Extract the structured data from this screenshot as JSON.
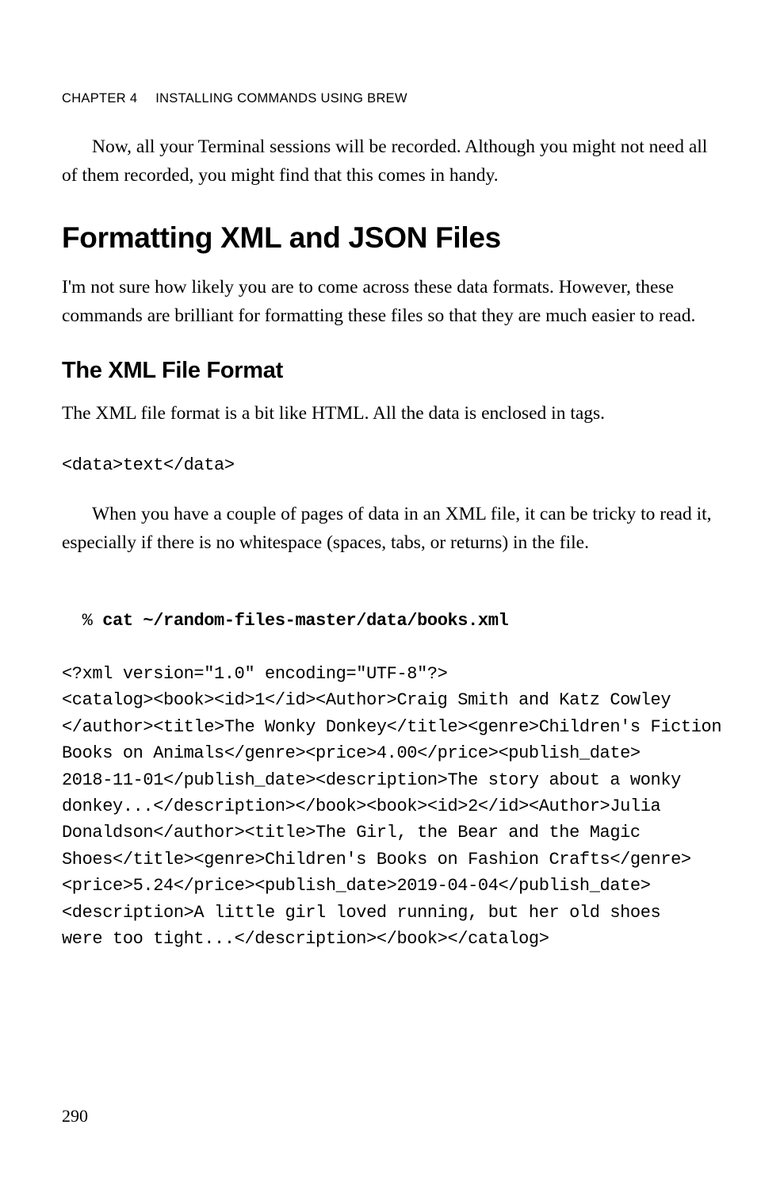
{
  "header": {
    "chapter_label": "CHAPTER 4",
    "chapter_title": "INSTALLING COMMANDS USING BREW"
  },
  "para_intro": "Now, all your Terminal sessions will be recorded. Although you might not need all of them recorded, you might find that this comes in handy.",
  "h1": "Formatting XML and JSON Files",
  "para_h1": "I'm not sure how likely you are to come across these data formats. However, these commands are brilliant for formatting these files so that they are much easier to read.",
  "h2": "The XML File Format",
  "para_h2a": "The XML file format is a bit like HTML. All the data is enclosed in tags.",
  "mono_example": "<data>text</data>",
  "para_h2b": "When you have a couple of pages of data in an XML file, it can be tricky to read it, especially if there is no whitespace (spaces, tabs, or returns) in the file.",
  "shell": {
    "prompt": "% ",
    "command": "cat ~/random-files-master/data/books.xml",
    "output": "<?xml version=\"1.0\" encoding=\"UTF-8\"?>\n<catalog><book><id>1</id><Author>Craig Smith and Katz Cowley\n</author><title>The Wonky Donkey</title><genre>Children's Fiction\nBooks on Animals</genre><price>4.00</price><publish_date>\n2018-11-01</publish_date><description>The story about a wonky\ndonkey...</description></book><book><id>2</id><Author>Julia\nDonaldson</author><title>The Girl, the Bear and the Magic\nShoes</title><genre>Children's Books on Fashion Crafts</genre>\n<price>5.24</price><publish_date>2019-04-04</publish_date>\n<description>A little girl loved running, but her old shoes\nwere too tight...</description></book></catalog>"
  },
  "page_number": "290"
}
